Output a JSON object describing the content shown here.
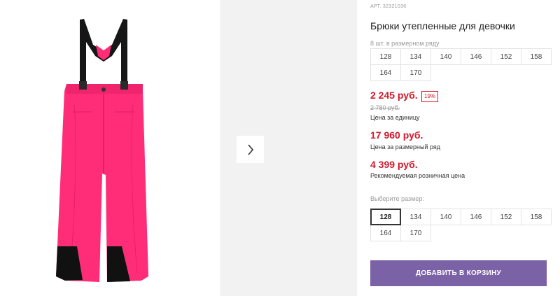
{
  "product": {
    "sku": "АРТ. 32321036",
    "title": "Брюки утепленные для девочки",
    "pack_note": "8 шт. в размерном ряду",
    "pack_sizes": [
      "128",
      "134",
      "140",
      "146",
      "152",
      "158",
      "164",
      "170"
    ],
    "price": "2 245 руб.",
    "discount": "19%",
    "old_price": "2 780 руб.",
    "price_unit_label": "Цена за единицу",
    "pack_price": "17 960 руб.",
    "pack_price_label": "Цена за размерный ряд",
    "rrp": "4 399 руб.",
    "rrp_label": "Рекомендуемая розничная цена",
    "choose_size_label": "Выберите размер:",
    "selectable_sizes": [
      "128",
      "134",
      "140",
      "146",
      "152",
      "158",
      "164",
      "170"
    ],
    "selected_size": "128",
    "add_to_cart": "ДОБАВИТЬ В КОРЗИНУ"
  },
  "gallery": {
    "main_image": "pink-snow-pants-with-suspenders",
    "next_icon": "chevron-right-icon"
  },
  "colors": {
    "accent_purple": "#7b61a6",
    "price_red": "#d2182b",
    "pants_pink": "#ff2d78"
  }
}
